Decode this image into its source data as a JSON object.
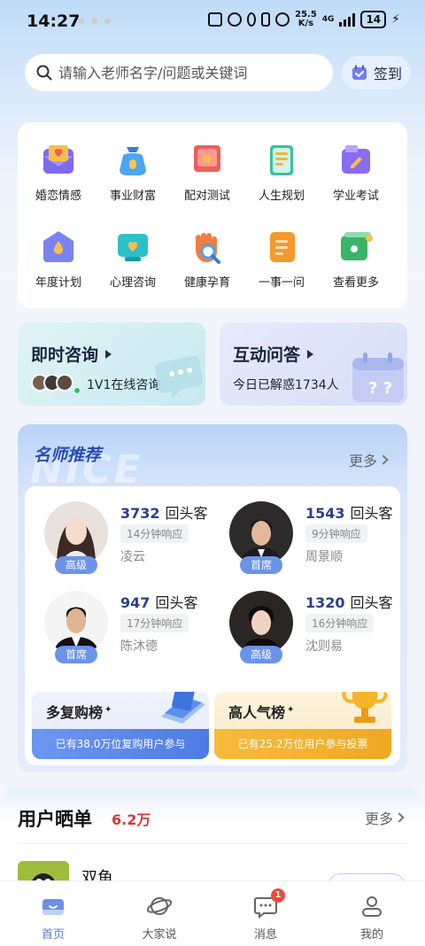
{
  "status_bar": {
    "time": "14:27",
    "net_speed_value": "25.5",
    "net_speed_unit": "K/s",
    "network": "4G",
    "battery": "14"
  },
  "search": {
    "placeholder": "请输入老师名字/问题或关键词",
    "signin_label": "签到"
  },
  "categories": [
    {
      "label": "婚恋情感",
      "icon": "heart-envelope-icon",
      "color": "#f2a93b"
    },
    {
      "label": "事业财富",
      "icon": "money-bag-icon",
      "color": "#4aa6f0"
    },
    {
      "label": "配对测试",
      "icon": "pair-ribbon-icon",
      "color": "#ef5d5d"
    },
    {
      "label": "人生规划",
      "icon": "scroll-icon",
      "color": "#39c1a2"
    },
    {
      "label": "学业考试",
      "icon": "folder-pencil-icon",
      "color": "#8a6cf0"
    },
    {
      "label": "年度计划",
      "icon": "house-drop-icon",
      "color": "#7b83f2"
    },
    {
      "label": "心理咨询",
      "icon": "heart-screen-icon",
      "color": "#2cc1c9"
    },
    {
      "label": "健康孕育",
      "icon": "hand-magnifier-icon",
      "color": "#f07d45"
    },
    {
      "label": "一事一问",
      "icon": "note-list-icon",
      "color": "#f39a2d"
    },
    {
      "label": "查看更多",
      "icon": "more-cards-icon",
      "color": "#39b46a"
    }
  ],
  "consult": {
    "instant": {
      "title": "即时咨询",
      "subtitle": "1V1在线咨询"
    },
    "interactive": {
      "title": "互动问答",
      "subtitle": "今日已解惑1734人"
    }
  },
  "teachers": {
    "title": "名师推荐",
    "bg_text": "NICE",
    "more_label": "更多",
    "list": [
      {
        "count": "3732",
        "count_label": "回头客",
        "response": "14分钟响应",
        "name": "凌云",
        "level": "高级"
      },
      {
        "count": "1543",
        "count_label": "回头客",
        "response": "9分钟响应",
        "name": "周景顺",
        "level": "首席"
      },
      {
        "count": "947",
        "count_label": "回头客",
        "response": "17分钟响应",
        "name": "陈沐德",
        "level": "首席"
      },
      {
        "count": "1320",
        "count_label": "回头客",
        "response": "16分钟响应",
        "name": "沈则易",
        "level": "高级"
      }
    ],
    "ranks": [
      {
        "title": "多复购榜",
        "desc": "已有38.0万位复购用户参与"
      },
      {
        "title": "高人气榜",
        "desc": "已有25.2万位用户参与投票"
      }
    ]
  },
  "user_show": {
    "title": "用户晒单",
    "count": "6.2万",
    "more_label": "更多",
    "first_name": "双鱼"
  },
  "bottom_nav": [
    {
      "label": "首页",
      "icon": "home-icon",
      "active": true
    },
    {
      "label": "大家说",
      "icon": "planet-icon",
      "active": false
    },
    {
      "label": "消息",
      "icon": "message-icon",
      "active": false,
      "badge": "1"
    },
    {
      "label": "我的",
      "icon": "profile-icon",
      "active": false
    }
  ],
  "colors": {
    "accent": "#5b78d0",
    "teacher_title": "#2b4eb2",
    "show_count": "#d93a3a",
    "badge": "#ee4a3a"
  }
}
